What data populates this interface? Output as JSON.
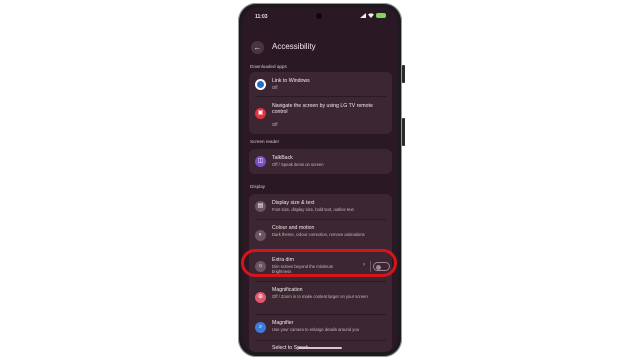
{
  "status_bar": {
    "time": "11:03"
  },
  "header": {
    "title": "Accessibility"
  },
  "sections": {
    "downloaded": "Downloaded apps",
    "screen_reader": "Screen reader",
    "display": "Display"
  },
  "items": {
    "link_windows": {
      "title": "Link to Windows",
      "subtitle": "Off"
    },
    "lg_tv": {
      "title": "Navigate the screen by using LG TV remote control",
      "subtitle": "Off"
    },
    "talkback": {
      "title": "TalkBack",
      "subtitle": "Off / Speak items on screen"
    },
    "display_size": {
      "title": "Display size & text",
      "subtitle": "Font size, display size, bold text, outline text"
    },
    "colour_motion": {
      "title": "Colour and motion",
      "subtitle": "Dark theme, colour correction, remove animations"
    },
    "extra_dim": {
      "title": "Extra dim",
      "subtitle": "Dim screen beyond the minimum brightness",
      "toggle_on": false
    },
    "magnification": {
      "title": "Magnification",
      "subtitle": "Off / Zoom in to make content larger on your screen"
    },
    "magnifier": {
      "title": "Magnifier",
      "subtitle": "Use your camera to enlarge details around you"
    },
    "select_to_speak": {
      "title": "Select to Speak"
    }
  },
  "icons": {
    "back": "back-arrow-icon",
    "link_windows": "link-to-windows-icon",
    "lg_tv": "tv-remote-icon",
    "talkback": "talkback-icon",
    "display_size": "display-size-icon",
    "colour_motion": "colour-motion-icon",
    "extra_dim": "extra-dim-icon",
    "magnification": "magnification-icon",
    "magnifier": "magnifier-icon"
  },
  "colors": {
    "background": "#2a1824",
    "card": "#3b2631",
    "highlight": "#d7141c"
  }
}
